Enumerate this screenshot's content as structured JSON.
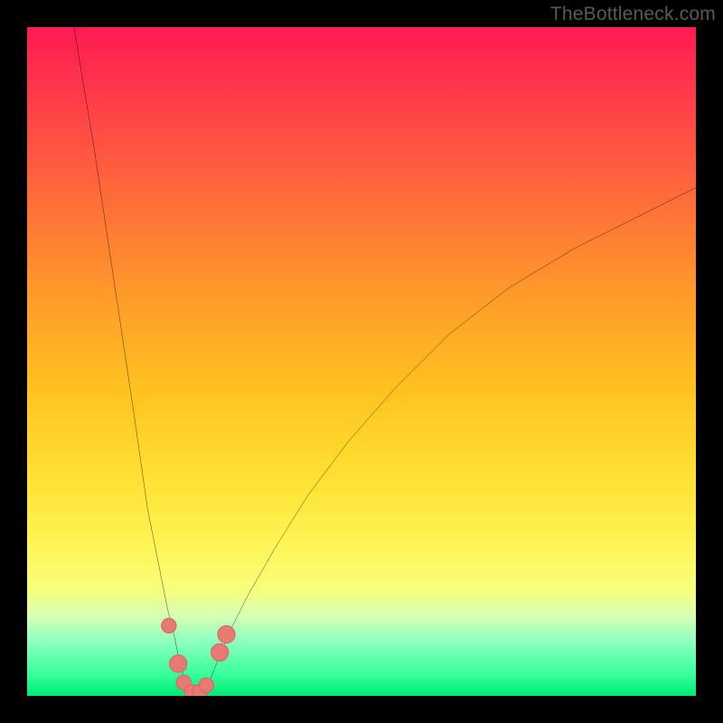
{
  "watermark": "TheBottleneck.com",
  "colors": {
    "frame": "#000000",
    "curve": "#000000",
    "marker_fill": "#e77a72",
    "marker_stroke": "#d46a63",
    "gradient_top": "#ff1a53",
    "gradient_bottom": "#00e876"
  },
  "chart_data": {
    "type": "line",
    "title": "",
    "xlabel": "",
    "ylabel": "",
    "xlim": [
      0,
      100
    ],
    "ylim": [
      0,
      100
    ],
    "series": [
      {
        "name": "bottleneck-curve",
        "x": [
          7,
          10,
          13,
          16,
          18,
          21,
          22,
          23,
          24,
          25,
          26,
          27,
          28,
          30,
          33,
          37,
          42,
          48,
          55,
          63,
          72,
          82,
          92,
          100
        ],
        "y": [
          100,
          82,
          62,
          42,
          28,
          13,
          9,
          4,
          1.5,
          0.5,
          0.5,
          1.5,
          4,
          9,
          15,
          22,
          30,
          38,
          46,
          54,
          61,
          67,
          72,
          76
        ]
      }
    ],
    "markers": [
      {
        "x": 21.2,
        "y": 10.5,
        "r": 1.1
      },
      {
        "x": 22.6,
        "y": 4.8,
        "r": 1.3
      },
      {
        "x": 23.4,
        "y": 2.0,
        "r": 1.1
      },
      {
        "x": 24.6,
        "y": 0.6,
        "r": 1.1
      },
      {
        "x": 25.8,
        "y": 0.6,
        "r": 1.1
      },
      {
        "x": 26.8,
        "y": 1.6,
        "r": 1.1
      },
      {
        "x": 28.8,
        "y": 6.5,
        "r": 1.3
      },
      {
        "x": 29.8,
        "y": 9.2,
        "r": 1.3
      }
    ]
  }
}
